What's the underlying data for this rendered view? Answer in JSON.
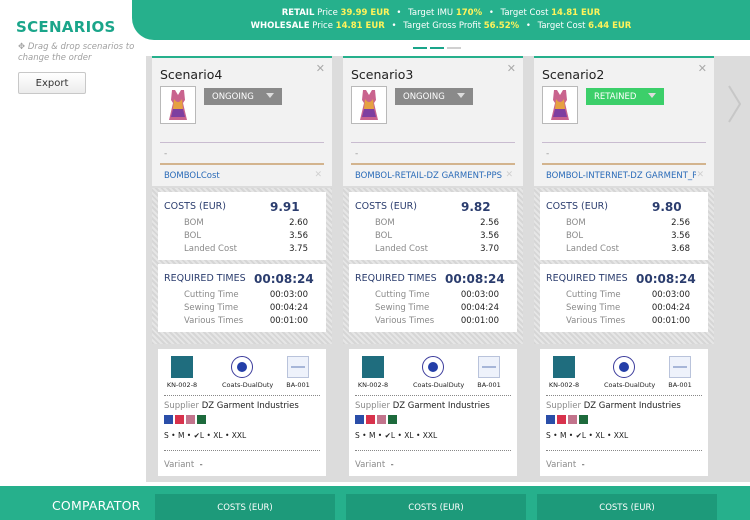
{
  "sidebar": {
    "title": "SCENARIOS",
    "hint": "Drag & drop scenarios to change the order",
    "export_label": "Export"
  },
  "banner": {
    "retail": {
      "label": "RETAIL",
      "price_label": "Price",
      "price": "39.99 EUR",
      "imu_label": "Target IMU",
      "imu": "170%",
      "cost_label": "Target Cost",
      "cost": "14.81 EUR"
    },
    "wholesale": {
      "label": "WHOLESALE",
      "price_label": "Price",
      "price": "14.81 EUR",
      "profit_label": "Target Gross Profit",
      "profit": "56.52%",
      "cost_label": "Target Cost",
      "cost": "6.44 EUR"
    }
  },
  "labels": {
    "costs": "COSTS (EUR)",
    "bom": "BOM",
    "bol": "BOL",
    "landed": "Landed Cost",
    "times": "REQUIRED TIMES",
    "cutting": "Cutting Time",
    "sewing": "Sewing Time",
    "various": "Various Times",
    "supplier": "Supplier",
    "variant": "Variant",
    "dash": "-"
  },
  "scenarios": [
    {
      "name": "Scenario4",
      "status": "ONGOING",
      "cost_ref": "BOMBOLCost",
      "costs": {
        "total": "9.91",
        "bom": "2.60",
        "bol": "3.56",
        "landed": "3.75"
      },
      "times": {
        "total": "00:08:24",
        "cutting": "00:03:00",
        "sewing": "00:04:24",
        "various": "00:01:00"
      },
      "materials": [
        "KN-002-8",
        "Coats-DualDuty",
        "BA-001"
      ],
      "supplier": "DZ Garment Industries",
      "sizes": "S • M • ✔L • XL • XXL",
      "variant": "-"
    },
    {
      "name": "Scenario3",
      "status": "ONGOING",
      "cost_ref": "BOMBOL-RETAIL-DZ GARMENT-PPS",
      "costs": {
        "total": "9.82",
        "bom": "2.56",
        "bol": "3.56",
        "landed": "3.70"
      },
      "times": {
        "total": "00:08:24",
        "cutting": "00:03:00",
        "sewing": "00:04:24",
        "various": "00:01:00"
      },
      "materials": [
        "KN-002-8",
        "Coats-DualDuty",
        "BA-001"
      ],
      "supplier": "DZ Garment Industries",
      "sizes": "S • M • ✔L • XL • XXL",
      "variant": "-"
    },
    {
      "name": "Scenario2",
      "status": "RETAINED",
      "cost_ref": "BOMBOL-INTERNET-DZ GARMENT_PPS",
      "costs": {
        "total": "9.80",
        "bom": "2.56",
        "bol": "3.56",
        "landed": "3.68"
      },
      "times": {
        "total": "00:08:24",
        "cutting": "00:03:00",
        "sewing": "00:04:24",
        "various": "00:01:00"
      },
      "materials": [
        "KN-002-8",
        "Coats-DualDuty",
        "BA-001"
      ],
      "supplier": "DZ Garment Industries",
      "sizes": "S • M • ✔L • XL • XXL",
      "variant": "-"
    }
  ],
  "comparator": {
    "title": "COMPARATOR",
    "tabs": [
      "COSTS (EUR)",
      "COSTS (EUR)",
      "COSTS (EUR)"
    ]
  },
  "colors": {
    "accent": "#26b08c",
    "title": "#1aa58a",
    "retained": "#3ccf6a",
    "ongoing": "#8a8a8a",
    "highlight": "#fff35a"
  }
}
